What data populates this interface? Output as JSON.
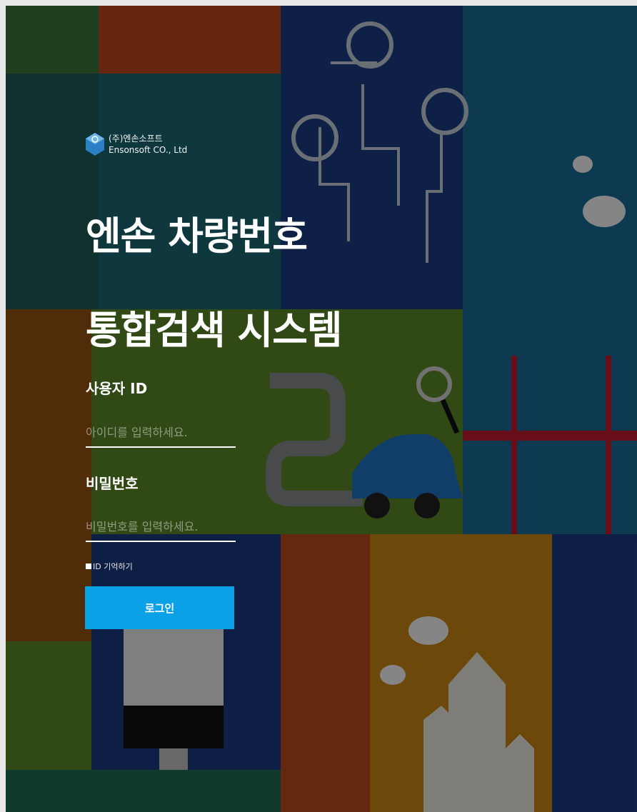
{
  "colors": {
    "accent": "#0aa1e6",
    "overlay": "rgba(0,0,0,0.48)"
  },
  "brand": {
    "logo_icon": "ensonsoft-cube-logo",
    "name_ko": "(주)엔손소프트",
    "name_en": "Ensonsoft CO., Ltd"
  },
  "title": {
    "line1": "엔손 차량번호",
    "line2": "통합검색 시스템"
  },
  "form": {
    "user_id_label": "사용자 ID",
    "user_id_placeholder": "아이디를 입력하세요.",
    "user_id_value": "",
    "password_label": "비밀번호",
    "password_placeholder": "비밀번호를 입력하세요.",
    "password_value": "",
    "remember_label": "ID 기억하기",
    "remember_checked": true,
    "login_button": "로그인"
  }
}
